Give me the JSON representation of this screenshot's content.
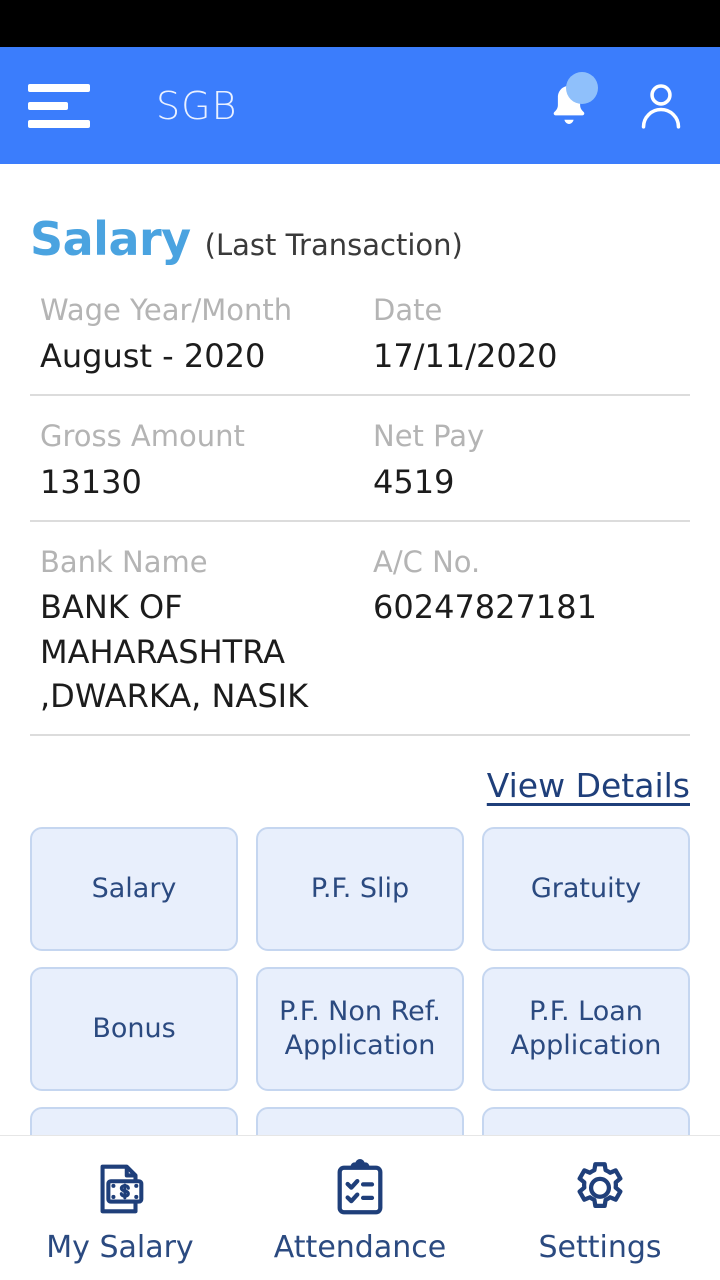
{
  "colors": {
    "header_blue": "#3b7dfc",
    "title_blue": "#4aa3e0",
    "link_navy": "#1f3f7a",
    "card_bg": "#e8effc",
    "card_border": "#c5d6f0",
    "nav_icon": "#1f3f7a",
    "label_gray": "#b4b4b4",
    "status_bar": "#000000",
    "notification_dot": "#8fc0fb"
  },
  "app_bar": {
    "title": "SGB",
    "menu_icon": "hamburger-menu-icon",
    "notification_icon": "bell-icon",
    "profile_icon": "person-icon",
    "has_notification": true
  },
  "page": {
    "title": "Salary",
    "subtitle": "(Last Transaction)"
  },
  "salary_details": [
    {
      "left_label": "Wage Year/Month",
      "left_value": "August - 2020",
      "right_label": "Date",
      "right_value": "17/11/2020"
    },
    {
      "left_label": "Gross Amount",
      "left_value": "13130",
      "right_label": "Net Pay",
      "right_value": "4519"
    },
    {
      "left_label": "Bank Name",
      "left_value": "BANK OF MAHARASHTRA ,DWARKA, NASIK",
      "right_label": "A/C No.",
      "right_value": "60247827181"
    }
  ],
  "view_details_link": "View Details",
  "grid_cards": [
    {
      "label": "Salary"
    },
    {
      "label": "P.F. Slip"
    },
    {
      "label": "Gratuity"
    },
    {
      "label": "Bonus"
    },
    {
      "label": "P.F. Non Ref. Application"
    },
    {
      "label": "P.F. Loan Application"
    },
    {
      "label": ""
    },
    {
      "label": ""
    },
    {
      "label": ""
    }
  ],
  "bottom_nav": [
    {
      "label": "My Salary",
      "icon": "document-money-icon"
    },
    {
      "label": "Attendance",
      "icon": "clipboard-check-icon"
    },
    {
      "label": "Settings",
      "icon": "gear-icon"
    }
  ]
}
